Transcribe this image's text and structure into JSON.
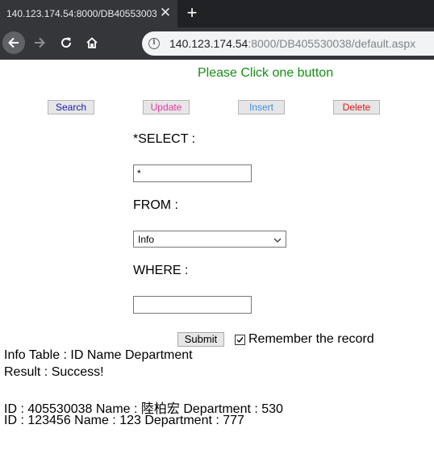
{
  "browser": {
    "tab_title": "140.123.174.54:8000/DB405530038/default.aspx",
    "tab_close": "✕",
    "new_tab": "+",
    "url_host": "140.123.174.54",
    "url_rest": ":8000/DB405530038/default.aspx",
    "info_icon": "i"
  },
  "page": {
    "heading": "Please Click one button",
    "buttons": {
      "search": "Search",
      "update": "Update",
      "insert": "Insert",
      "delete": "Delete"
    },
    "form": {
      "select_label": "*SELECT :",
      "select_value": "*",
      "from_label": "FROM :",
      "from_value": "Info",
      "where_label": "WHERE :",
      "where_value": "",
      "submit_label": "Submit",
      "remember_label": "Remember the record",
      "remember_checked": true
    },
    "results": {
      "table_line": "Info Table : ID Name Department",
      "result_line": "Result : Success!",
      "records": [
        "ID : 405530038 Name : 陸柏宏 Department : 530",
        "ID : 123456 Name : 123 Department : 777"
      ]
    }
  },
  "colors": {
    "heading": "#149014",
    "search": "#1a1ab8",
    "update": "#e43ca4",
    "insert": "#3d8fe0",
    "delete": "#e01818"
  }
}
